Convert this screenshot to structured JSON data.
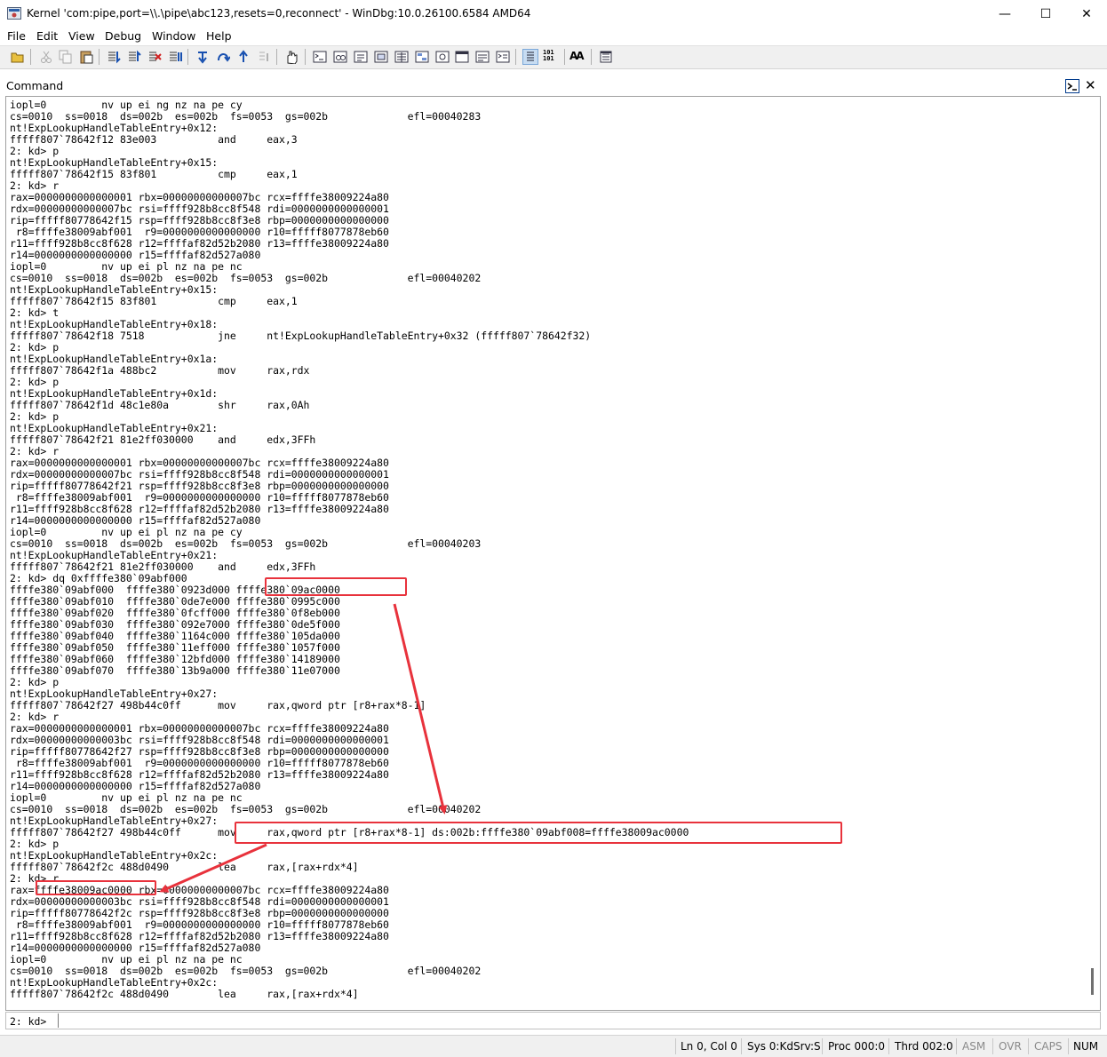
{
  "window": {
    "title": "Kernel 'com:pipe,port=\\\\.\\pipe\\abc123,resets=0,reconnect' - WinDbg:10.0.26100.6584 AMD64",
    "minimize_glyph": "—",
    "maximize_glyph": "☐",
    "close_glyph": "✕"
  },
  "menu": [
    "File",
    "Edit",
    "View",
    "Debug",
    "Window",
    "Help"
  ],
  "toolbar": {
    "icons": [
      "open-icon",
      "cut-icon",
      "copy-icon",
      "paste-icon",
      "go-icon",
      "restart-icon",
      "stop-debugging-icon",
      "break-icon",
      "step-into-icon",
      "step-over-icon",
      "step-out-icon",
      "run-to-cursor-icon",
      "breakpoint-hand-icon",
      "command-window-icon",
      "watch-window-icon",
      "locals-window-icon",
      "registers-window-icon",
      "memory-window-icon",
      "call-stack-icon",
      "disassembly-window-icon",
      "scratch-pad-icon",
      "processes-threads-icon",
      "source-mode-icon",
      "hex-mode-icon",
      "font-icon",
      "options-icon"
    ],
    "hex_glyph": "101\n101",
    "font_glyph": "AA"
  },
  "command_window": {
    "title": "Command",
    "close_glyph": "✕",
    "output_lines": [
      "iopl=0         nv up ei ng nz na pe cy",
      "cs=0010  ss=0018  ds=002b  es=002b  fs=0053  gs=002b             efl=00040283",
      "nt!ExpLookupHandleTableEntry+0x12:",
      "fffff807`78642f12 83e003          and     eax,3",
      "2: kd> p",
      "nt!ExpLookupHandleTableEntry+0x15:",
      "fffff807`78642f15 83f801          cmp     eax,1",
      "2: kd> r",
      "rax=0000000000000001 rbx=00000000000007bc rcx=ffffe38009224a80",
      "rdx=00000000000007bc rsi=ffff928b8cc8f548 rdi=0000000000000001",
      "rip=fffff80778642f15 rsp=ffff928b8cc8f3e8 rbp=0000000000000000",
      " r8=ffffe38009abf001  r9=0000000000000000 r10=fffff8077878eb60",
      "r11=ffff928b8cc8f628 r12=ffffaf82d52b2080 r13=ffffe38009224a80",
      "r14=0000000000000000 r15=ffffaf82d527a080",
      "iopl=0         nv up ei pl nz na pe nc",
      "cs=0010  ss=0018  ds=002b  es=002b  fs=0053  gs=002b             efl=00040202",
      "nt!ExpLookupHandleTableEntry+0x15:",
      "fffff807`78642f15 83f801          cmp     eax,1",
      "2: kd> t",
      "nt!ExpLookupHandleTableEntry+0x18:",
      "fffff807`78642f18 7518            jne     nt!ExpLookupHandleTableEntry+0x32 (fffff807`78642f32)",
      "2: kd> p",
      "nt!ExpLookupHandleTableEntry+0x1a:",
      "fffff807`78642f1a 488bc2          mov     rax,rdx",
      "2: kd> p",
      "nt!ExpLookupHandleTableEntry+0x1d:",
      "fffff807`78642f1d 48c1e80a        shr     rax,0Ah",
      "2: kd> p",
      "nt!ExpLookupHandleTableEntry+0x21:",
      "fffff807`78642f21 81e2ff030000    and     edx,3FFh",
      "2: kd> r",
      "rax=0000000000000001 rbx=00000000000007bc rcx=ffffe38009224a80",
      "rdx=00000000000007bc rsi=ffff928b8cc8f548 rdi=0000000000000001",
      "rip=fffff80778642f21 rsp=ffff928b8cc8f3e8 rbp=0000000000000000",
      " r8=ffffe38009abf001  r9=0000000000000000 r10=fffff8077878eb60",
      "r11=ffff928b8cc8f628 r12=ffffaf82d52b2080 r13=ffffe38009224a80",
      "r14=0000000000000000 r15=ffffaf82d527a080",
      "iopl=0         nv up ei pl nz na pe cy",
      "cs=0010  ss=0018  ds=002b  es=002b  fs=0053  gs=002b             efl=00040203",
      "nt!ExpLookupHandleTableEntry+0x21:",
      "fffff807`78642f21 81e2ff030000    and     edx,3FFh",
      "2: kd> dq 0xffffe380`09abf000",
      "ffffe380`09abf000  ffffe380`0923d000 ffffe380`09ac0000",
      "ffffe380`09abf010  ffffe380`0de7e000 ffffe380`0995c000",
      "ffffe380`09abf020  ffffe380`0fcff000 ffffe380`0f8eb000",
      "ffffe380`09abf030  ffffe380`092e7000 ffffe380`0de5f000",
      "ffffe380`09abf040  ffffe380`1164c000 ffffe380`105da000",
      "ffffe380`09abf050  ffffe380`11eff000 ffffe380`1057f000",
      "ffffe380`09abf060  ffffe380`12bfd000 ffffe380`14189000",
      "ffffe380`09abf070  ffffe380`13b9a000 ffffe380`11e07000",
      "2: kd> p",
      "nt!ExpLookupHandleTableEntry+0x27:",
      "fffff807`78642f27 498b44c0ff      mov     rax,qword ptr [r8+rax*8-1]",
      "2: kd> r",
      "rax=0000000000000001 rbx=00000000000007bc rcx=ffffe38009224a80",
      "rdx=00000000000003bc rsi=ffff928b8cc8f548 rdi=0000000000000001",
      "rip=fffff80778642f27 rsp=ffff928b8cc8f3e8 rbp=0000000000000000",
      " r8=ffffe38009abf001  r9=0000000000000000 r10=fffff8077878eb60",
      "r11=ffff928b8cc8f628 r12=ffffaf82d52b2080 r13=ffffe38009224a80",
      "r14=0000000000000000 r15=ffffaf82d527a080",
      "iopl=0         nv up ei pl nz na pe nc",
      "cs=0010  ss=0018  ds=002b  es=002b  fs=0053  gs=002b             efl=00040202",
      "nt!ExpLookupHandleTableEntry+0x27:",
      "fffff807`78642f27 498b44c0ff      mov     rax,qword ptr [r8+rax*8-1] ds:002b:ffffe380`09abf008=ffffe38009ac0000",
      "2: kd> p",
      "nt!ExpLookupHandleTableEntry+0x2c:",
      "fffff807`78642f2c 488d0490        lea     rax,[rax+rdx*4]",
      "2: kd> r",
      "rax=ffffe38009ac0000 rbx=00000000000007bc rcx=ffffe38009224a80",
      "rdx=00000000000003bc rsi=ffff928b8cc8f548 rdi=0000000000000001",
      "rip=fffff80778642f2c rsp=ffff928b8cc8f3e8 rbp=0000000000000000",
      " r8=ffffe38009abf001  r9=0000000000000000 r10=fffff8077878eb60",
      "r11=ffff928b8cc8f628 r12=ffffaf82d52b2080 r13=ffffe38009224a80",
      "r14=0000000000000000 r15=ffffaf82d527a080",
      "iopl=0         nv up ei pl nz na pe nc",
      "cs=0010  ss=0018  ds=002b  es=002b  fs=0053  gs=002b             efl=00040202",
      "nt!ExpLookupHandleTableEntry+0x2c:",
      "fffff807`78642f2c 488d0490        lea     rax,[rax+rdx*4]"
    ],
    "prompt": "2: kd>",
    "input_value": ""
  },
  "annotations": {
    "color": "#e8323c"
  },
  "statusbar": {
    "position": "Ln 0, Col 0",
    "sys": "Sys 0:KdSrv:S",
    "proc": "Proc 000:0",
    "thread": "Thrd 002:0",
    "asm": "ASM",
    "ovr": "OVR",
    "caps": "CAPS",
    "num": "NUM"
  }
}
